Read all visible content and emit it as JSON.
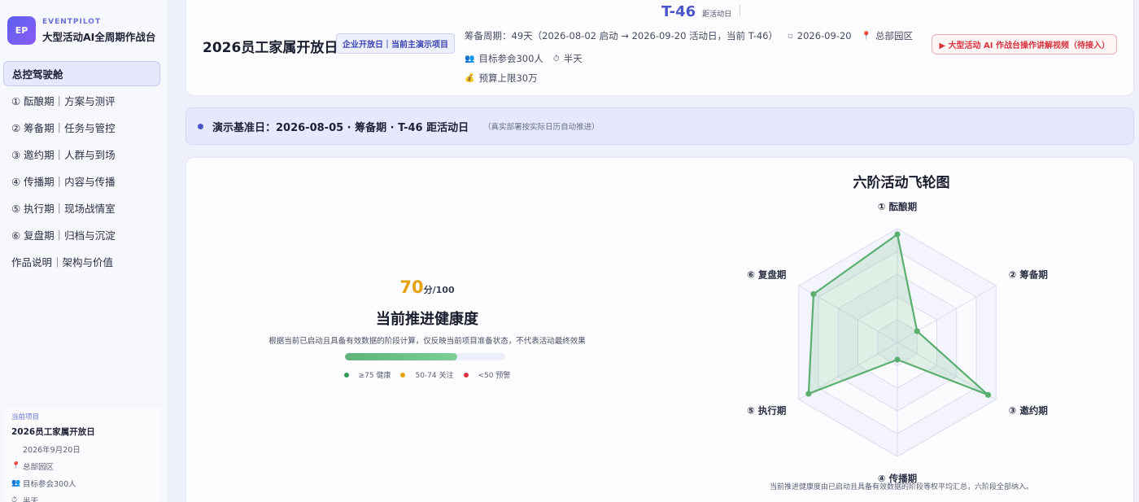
{
  "brand": {
    "logo": "EP",
    "eyebrow": "EVENTPILOT",
    "title": "大型活动AI全周期作战台"
  },
  "nav": [
    {
      "label": "总控驾驶舱",
      "active": true
    },
    {
      "label": "① 酝酿期｜方案与测评"
    },
    {
      "label": "② 筹备期｜任务与管控"
    },
    {
      "label": "③ 邀约期｜人群与到场"
    },
    {
      "label": "④ 传播期｜内容与传播"
    },
    {
      "label": "⑤ 执行期｜现场战情室"
    },
    {
      "label": "⑥ 复盘期｜归档与沉淀"
    },
    {
      "label": "作品说明｜架构与价值"
    }
  ],
  "project_card": {
    "eyebrow": "当前项目",
    "name": "2026员工家属开放日",
    "date": "2026年9月20日",
    "location": "总部园区",
    "attendance": "目标参会300人",
    "duration": "半天"
  },
  "header": {
    "countdown": "T-46",
    "countdown_label": "距活动日",
    "title": "2026员工家属开放日",
    "tag": "企业开放日｜当前主演示项目",
    "cycle": "筹备周期：49天（2026-08-02 启动 → 2026-09-20 活动日，当前 T-46）",
    "date": "2026-09-20",
    "location": "总部园区",
    "attendance": "目标参会300人",
    "duration": "半天",
    "budget": "预算上限30万",
    "video_button": "▶ 大型活动 AI 作战台操作讲解视频（待接入）"
  },
  "banner": {
    "text": "演示基准日：2026-08-05 · 筹备期 · T-46 距活动日",
    "note": "（真实部署按实际日历自动推进）"
  },
  "health": {
    "score": "70",
    "unit": "分/100",
    "score_value": 70,
    "score_max": 100,
    "title": "当前推进健康度",
    "desc": "根据当前已启动且具备有效数据的阶段计算，仅反映当前项目准备状态，不代表活动最终效果",
    "legend": [
      {
        "label": "≥75 健康",
        "color": "#2f9e55"
      },
      {
        "label": "50-74 关注",
        "color": "#e6a10e"
      },
      {
        "label": "<50 预警",
        "color": "#d7343f"
      }
    ]
  },
  "chart_data": {
    "type": "radar",
    "title": "六阶活动飞轮图",
    "axes": [
      "① 酝酿期",
      "② 筹备期",
      "③ 邀约期",
      "④ 传播期",
      "⑤ 执行期",
      "⑥ 复盘期"
    ],
    "values": [
      95,
      20,
      92,
      15,
      90,
      85
    ],
    "rmax": 100,
    "rings": 5,
    "series_color": "#5aae6f",
    "note": "当前推进健康度由已启动且具备有效数据的阶段等权平均汇总，六阶段全部纳入。"
  }
}
